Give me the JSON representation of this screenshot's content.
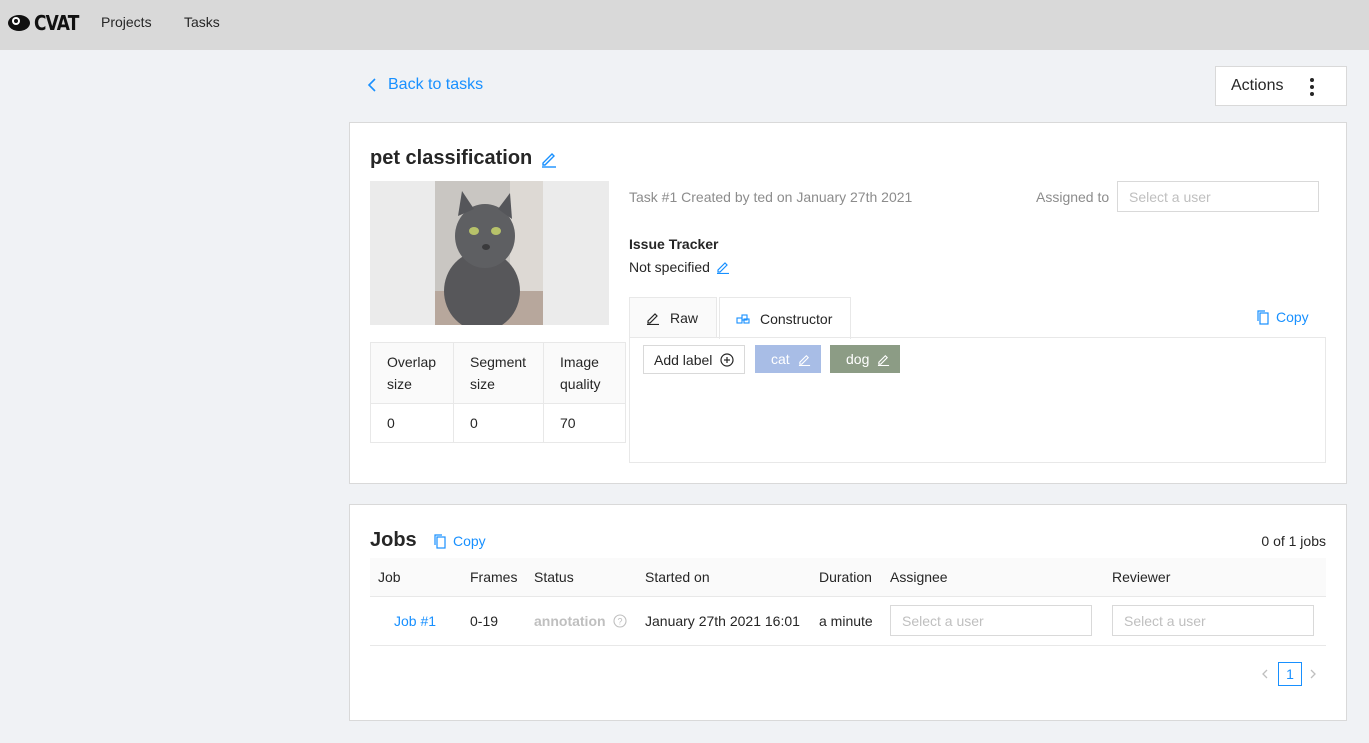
{
  "app": {
    "logo_text": "CVAT"
  },
  "nav": {
    "projects": "Projects",
    "tasks": "Tasks"
  },
  "header": {
    "back_label": "Back to tasks",
    "actions_label": "Actions"
  },
  "task": {
    "title": "pet classification",
    "meta": "Task #1 Created by ted on January 27th 2021",
    "assigned_label": "Assigned to",
    "assignee_placeholder": "Select a user",
    "issue_tracker_title": "Issue Tracker",
    "issue_tracker_value": "Not specified",
    "params": {
      "headers": [
        "Overlap size",
        "Segment size",
        "Image quality"
      ],
      "values": [
        "0",
        "0",
        "70"
      ]
    },
    "tabs": {
      "raw": "Raw",
      "constructor": "Constructor",
      "copy": "Copy"
    },
    "add_label": "Add label",
    "labels": [
      {
        "name": "cat",
        "color": "#a8bde6"
      },
      {
        "name": "dog",
        "color": "#8c9c85"
      }
    ]
  },
  "jobs": {
    "title": "Jobs",
    "copy": "Copy",
    "count": "0 of 1 jobs",
    "columns": [
      "Job",
      "Frames",
      "Status",
      "Started on",
      "Duration",
      "Assignee",
      "Reviewer"
    ],
    "rows": [
      {
        "job": "Job #1",
        "frames": "0-19",
        "status": "annotation",
        "started": "January 27th 2021 16:01",
        "duration": "a minute",
        "assignee_placeholder": "Select a user",
        "reviewer_placeholder": "Select a user"
      }
    ],
    "page": "1"
  },
  "colors": {
    "accent": "#1890ff",
    "topbar": "#d9d9d9",
    "background": "#f0f2f5"
  }
}
